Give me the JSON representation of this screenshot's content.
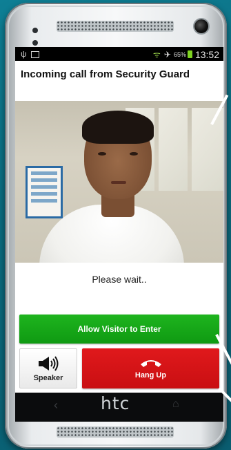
{
  "device": {
    "brand": "htc"
  },
  "status_bar": {
    "battery": "65%",
    "time": "13:52"
  },
  "call": {
    "title": "Incoming call from Security Guard",
    "status": "Please wait.."
  },
  "actions": {
    "allow": "Allow Visitor to Enter",
    "speaker": "Speaker",
    "hang_up": "Hang Up"
  },
  "icons": {
    "speaker": "speaker-volume-icon",
    "hang_up": "phone-hang-up-icon",
    "usb": "usb-icon",
    "image": "image-icon",
    "wifi": "wifi-icon",
    "airplane": "airplane-mode-icon",
    "battery": "battery-icon"
  },
  "colors": {
    "allow": "#12a315",
    "hang_up": "#d9161a",
    "background": "#0b6c80"
  }
}
